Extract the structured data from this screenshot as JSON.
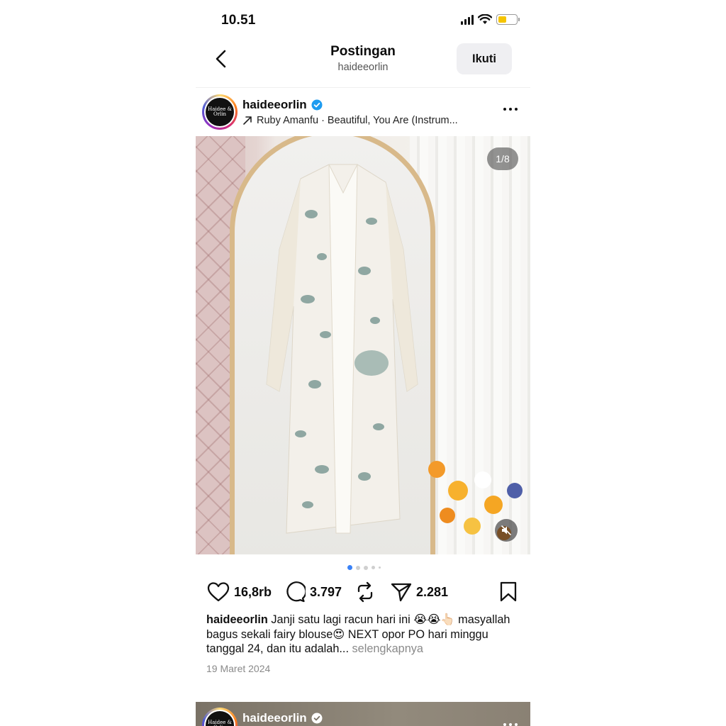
{
  "status_bar": {
    "time": "10.51"
  },
  "header": {
    "title": "Postingan",
    "subtitle": "haideeorlin",
    "follow_label": "Ikuti"
  },
  "post": {
    "username": "haideeorlin",
    "avatar_text": "Haidee & Orlin",
    "music": "Ruby Amanfu · Beautiful, You Are (Instrum...",
    "slide_indicator": "1/8",
    "likes": "16,8rb",
    "comments": "3.797",
    "shares": "2.281",
    "caption_user": "haideeorlin",
    "caption_text": "Janji satu lagi racun hari ini 😭😭👆🏻 masyallah bagus sekali fairy blouse😍 NEXT opor PO hari minggu tanggal 24, dan itu adalah...",
    "caption_more": "selengkapnya",
    "date": "19 Maret 2024"
  },
  "next_post": {
    "username": "haideeorlin"
  },
  "colors": {
    "accent_dot": "#3a82f7",
    "verified": "#1d9bf0",
    "battery": "#f5c400"
  }
}
